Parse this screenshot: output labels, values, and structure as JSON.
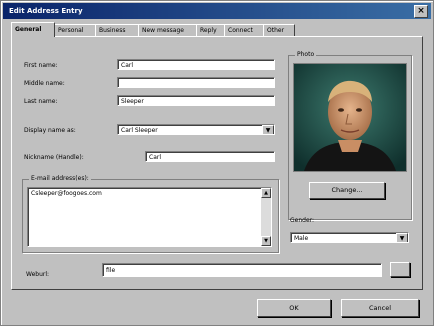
{
  "window": {
    "title": "Edit Address Entry"
  },
  "tabs": [
    {
      "label": "General"
    },
    {
      "label": "Personal"
    },
    {
      "label": "Business"
    },
    {
      "label": "New message"
    },
    {
      "label": "Reply"
    },
    {
      "label": "Connect"
    },
    {
      "label": "Other"
    }
  ],
  "form": {
    "first_name_label": "First name:",
    "first_name_value": "Carl",
    "middle_name_label": "Middle name:",
    "middle_name_value": "",
    "last_name_label": "Last name:",
    "last_name_value": "Sleeper",
    "display_name_label": "Display name as:",
    "display_name_value": "Carl Sleeper",
    "nickname_label": "Nickname (Handle):",
    "nickname_value": "Carl",
    "email_group_label": "E-mail address(es):",
    "emails": [
      "Csleeper@foogoes.com"
    ],
    "weburl_label": "Weburl:",
    "weburl_value": "file"
  },
  "photo": {
    "group_label": "Photo",
    "change_label": "Change..."
  },
  "gender": {
    "label": "Gender:",
    "value": "Male"
  },
  "buttons": {
    "ok": "OK",
    "cancel": "Cancel"
  },
  "colors": {
    "titlebar_start": "#0a246a",
    "titlebar_end": "#3a6ea5",
    "face": "#c0c0c0"
  }
}
